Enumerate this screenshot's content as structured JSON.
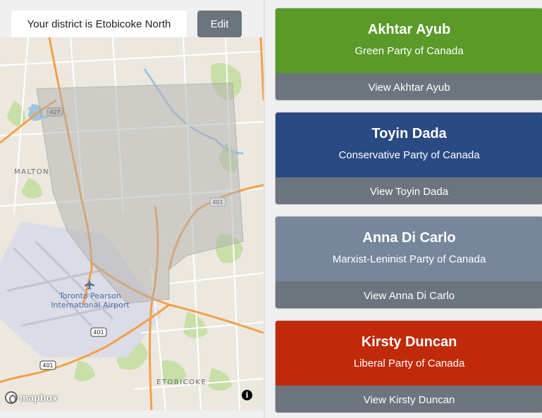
{
  "district": {
    "text": "Your district is Etobicoke North",
    "edit_label": "Edit"
  },
  "map": {
    "labels": {
      "malton": "MALTON",
      "airport": "Toronto Pearson\nInternational Airport",
      "etobicoke": "ETOBICOKE"
    },
    "shields": [
      "427",
      "401",
      "401",
      "401"
    ],
    "attribution": "mapbox",
    "info_glyph": "i"
  },
  "candidates": [
    {
      "name": "Akhtar Ayub",
      "party": "Green Party of Canada",
      "button": "View Akhtar Ayub",
      "color": "#5a9a28"
    },
    {
      "name": "Toyin Dada",
      "party": "Conservative Party of Canada",
      "button": "View Toyin Dada",
      "color": "#2a4a84"
    },
    {
      "name": "Anna Di Carlo",
      "party": "Marxist-Leninist Party of Canada",
      "button": "View Anna Di Carlo",
      "color": "#76879c"
    },
    {
      "name": "Kirsty Duncan",
      "party": "Liberal Party of Canada",
      "button": "View Kirsty Duncan",
      "color": "#c02a0a"
    }
  ]
}
